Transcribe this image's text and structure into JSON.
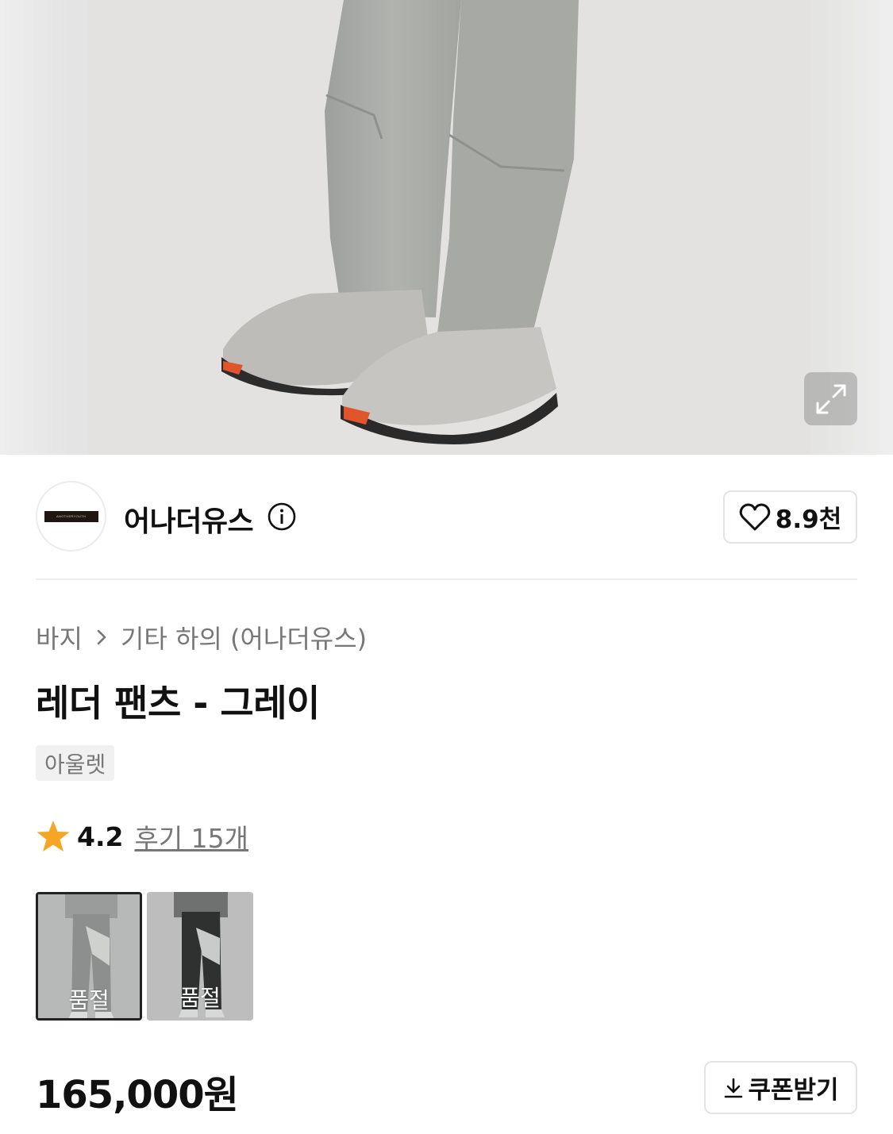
{
  "brand": {
    "logo_text": "ANOTHERYOUTH",
    "name": "어나더유스",
    "likes": "8.9천"
  },
  "breadcrumb": {
    "category": "바지",
    "subcategory": "기타 하의 (어나더유스)"
  },
  "product": {
    "title": "레더 팬츠 - 그레이",
    "tag": "아울렛",
    "rating": "4.2",
    "reviews": "후기 15개",
    "price": "165,000원"
  },
  "thumbnails": [
    {
      "status": "품절",
      "selected": true,
      "color": "gray"
    },
    {
      "status": "품절",
      "selected": false,
      "color": "black"
    }
  ],
  "buttons": {
    "coupon": "쿠폰받기"
  },
  "colors": {
    "star": "#f5a623",
    "text": "#111111",
    "muted": "#777777"
  }
}
